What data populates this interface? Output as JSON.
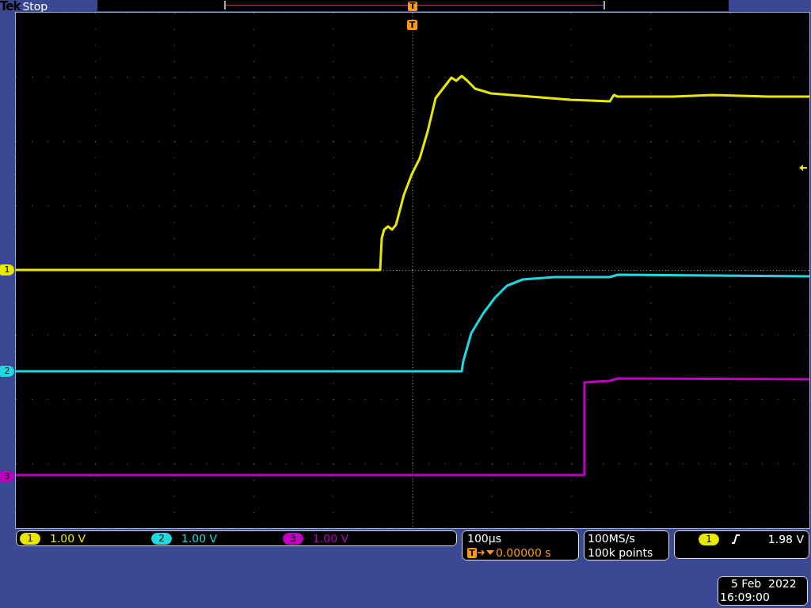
{
  "top_bar": {
    "brand": "Tek",
    "status": "Stop",
    "trigger_marker": "T"
  },
  "graticule": {
    "trigger_marker": "T"
  },
  "channels": [
    {
      "marker": "1",
      "color": "#e8e800",
      "badge": "1",
      "scale": "1.00 V"
    },
    {
      "marker": "2",
      "color": "#20d8e0",
      "badge": "2",
      "scale": "1.00 V"
    },
    {
      "marker": "3",
      "color": "#c000c0",
      "badge": "3",
      "scale": "1.00 V"
    }
  ],
  "timebase": {
    "scale": "100µs",
    "trigger_icon": "T",
    "delay": "0.00000 s"
  },
  "acquisition": {
    "sample_rate": "100MS/s",
    "record_length": "100k points"
  },
  "trigger": {
    "source": "1",
    "level": "1.98 V"
  },
  "timestamp": {
    "date": "5 Feb  2022",
    "time": "16:09:00"
  }
}
